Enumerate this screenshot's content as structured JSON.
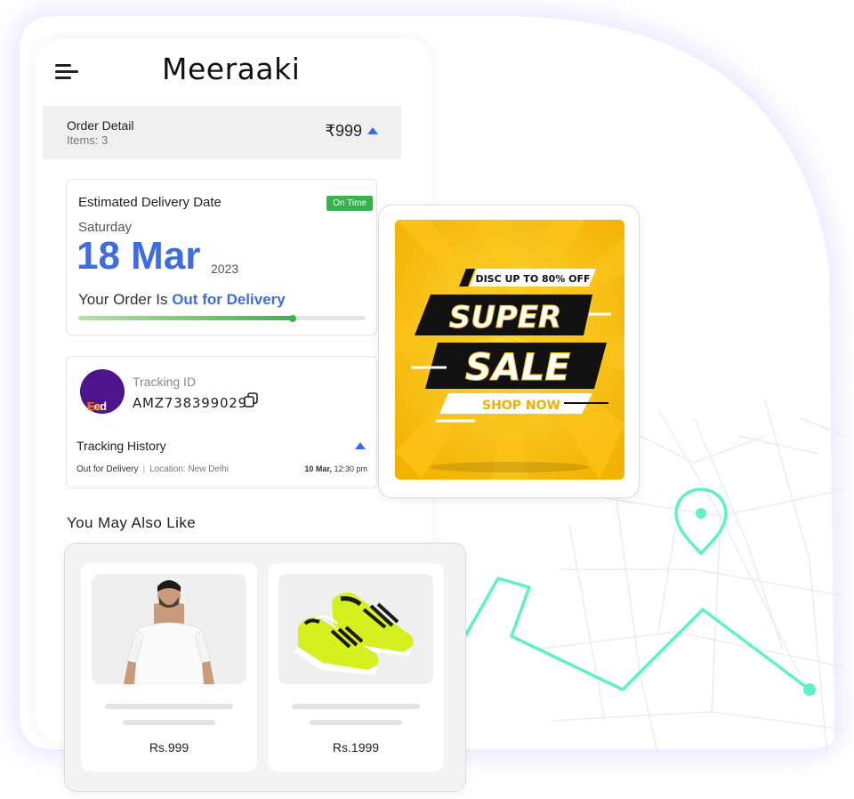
{
  "brand": "Meeraaki",
  "order": {
    "title": "Order Detail",
    "items": "Items: 3",
    "price": "₹999"
  },
  "delivery": {
    "label": "Estimated Delivery Date",
    "badge": "On Time",
    "day": "Saturday",
    "date": "18 Mar",
    "year": "2023",
    "status_prefix": "Your Order Is ",
    "status_value": "Out for Delivery",
    "progress_percent": 75
  },
  "tracking": {
    "courier_logo_text_1": "Fed",
    "courier_logo_text_2": "Ex",
    "id_label": "Tracking ID",
    "id_value": "AMZ738399029",
    "history_label": "Tracking History",
    "event_status": "Out for Delivery",
    "event_location": "Location: New Delhi",
    "event_date": "10 Mar,",
    "event_time": "12:30 pm"
  },
  "recommendations": {
    "heading": "You May Also Like",
    "products": [
      {
        "price": "Rs.999",
        "image": "white-tshirt"
      },
      {
        "price": "Rs.1999",
        "image": "green-sneakers"
      }
    ]
  },
  "sale_banner": {
    "top_text": "DISC UP TO 80% OFF",
    "word1": "SUPER",
    "word2": "SALE",
    "cta": "SHOP NOW"
  },
  "colors": {
    "accent": "#3e6de0",
    "success": "#37b24d",
    "route": "#5ff0c4",
    "sale_yellow": "#f5b800"
  }
}
